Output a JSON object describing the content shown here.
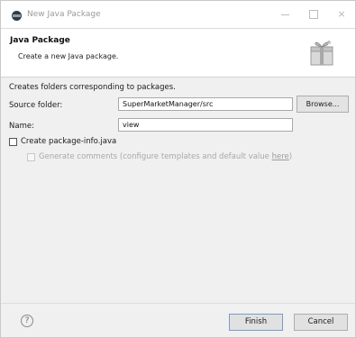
{
  "window": {
    "title": "New Java Package"
  },
  "banner": {
    "title": "Java Package",
    "description": "Create a new Java package."
  },
  "form": {
    "info": "Creates folders corresponding to packages.",
    "source_folder_label": "Source folder:",
    "source_folder_value": "SuperMarketManager/src",
    "browse_label": "Browse...",
    "name_label": "Name:",
    "name_value": "view",
    "create_package_info_label": "Create package-info.java",
    "create_package_info_checked": false,
    "generate_comments_prefix": "Generate comments (configure templates and default value ",
    "generate_comments_link": "here",
    "generate_comments_suffix": ")",
    "generate_comments_checked": false
  },
  "footer": {
    "help_glyph": "?",
    "finish_label": "Finish",
    "cancel_label": "Cancel"
  },
  "icons": {
    "app": "eclipse-app-icon",
    "banner": "java-package-wizard-icon",
    "help": "help-icon",
    "minimize": "minimize-icon",
    "maximize": "maximize-icon",
    "close": "close-icon"
  },
  "colors": {
    "window_background": "#f0f0f0",
    "banner_background": "#ffffff",
    "disabled_text": "#a8a8a8",
    "default_button_border": "#7a9cc6"
  }
}
